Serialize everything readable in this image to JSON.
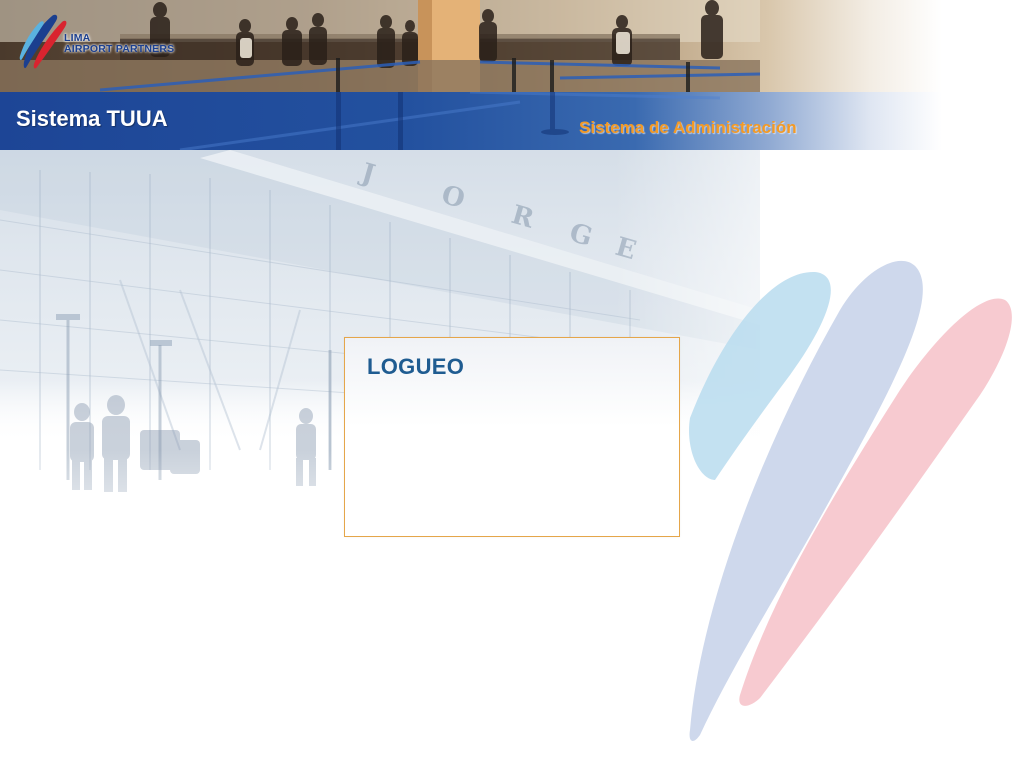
{
  "header": {
    "logo_line1": "LIMA",
    "logo_line2": "AIRPORT PARTNERS",
    "system_title": "Sistema TUUA",
    "system_subtitle": "Sistema de Administración"
  },
  "login": {
    "title": "LOGUEO"
  },
  "colors": {
    "header_bar": "#1d4596",
    "subtitle": "#f39a26",
    "login_title": "#1f5c91",
    "panel_border": "#e5a64a"
  }
}
